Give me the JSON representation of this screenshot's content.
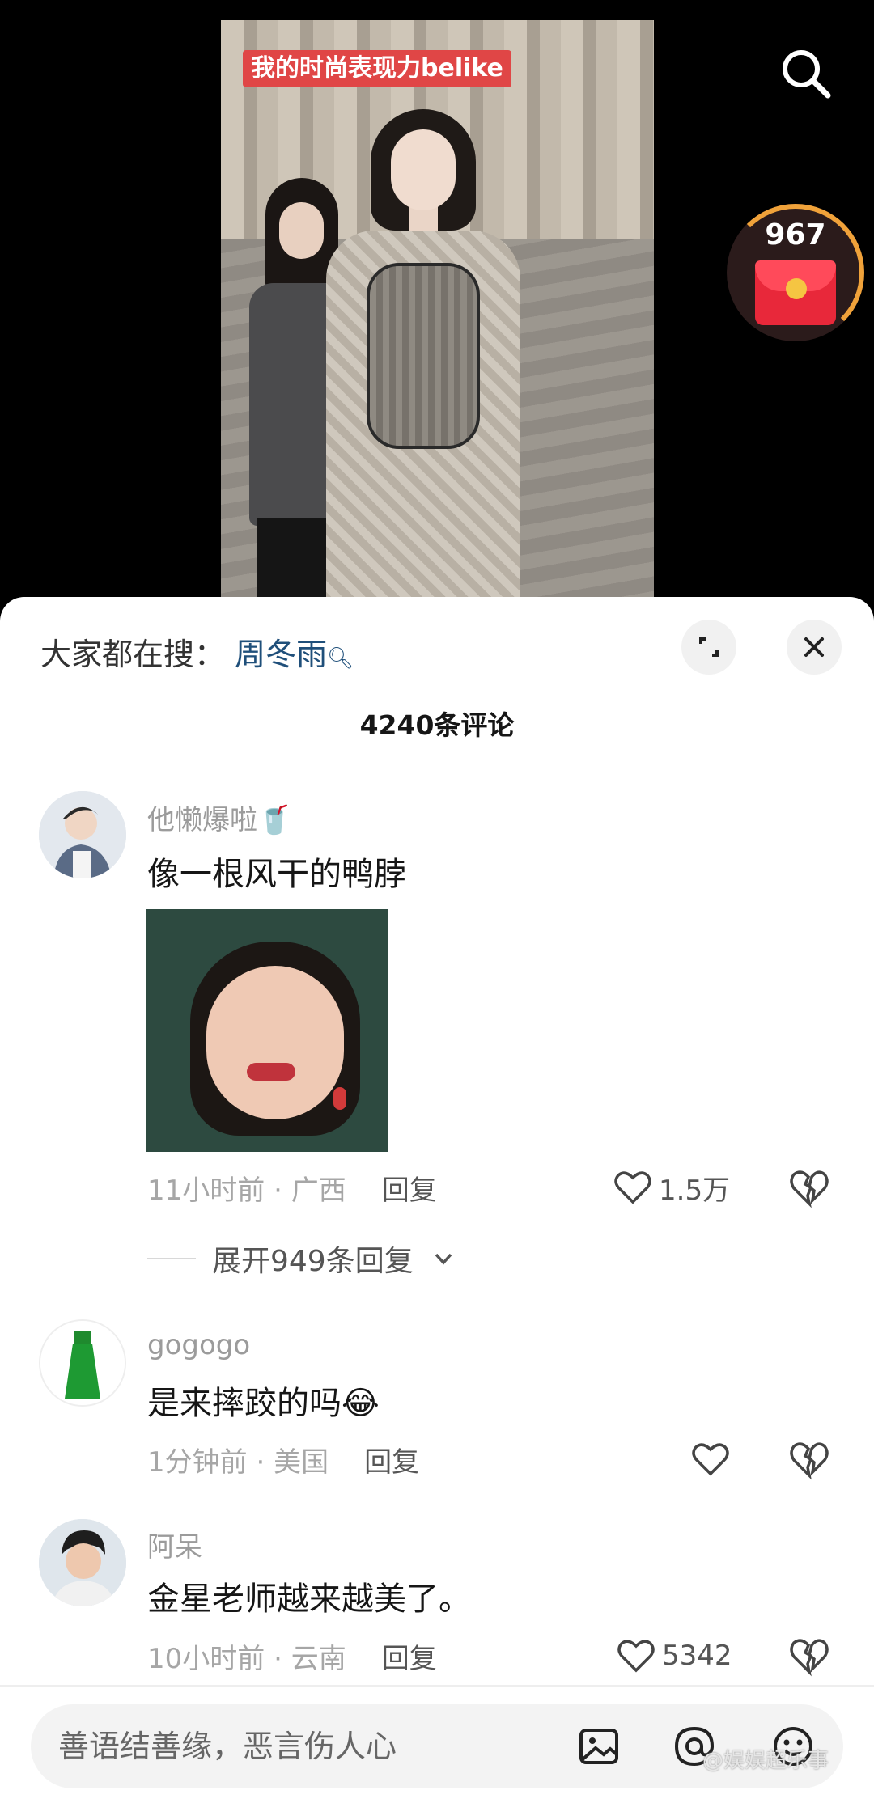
{
  "video": {
    "caption": "我的时尚表现力belike",
    "reward_count": "967"
  },
  "sheet": {
    "hot_search_label": "大家都在搜：",
    "hot_search_term": "周冬雨",
    "comment_count": "4240条评论",
    "expand_replies_label": "展开949条回复"
  },
  "comments": [
    {
      "username": "他懒爆啦🥤",
      "text": "像一根风干的鸭脖",
      "time": "11小时前",
      "location": "广西",
      "reply_label": "回复",
      "likes": "1.5万"
    },
    {
      "username": "gogogo",
      "text": "是来摔跤的吗😂",
      "time": "1分钟前",
      "location": "美国",
      "reply_label": "回复",
      "likes": ""
    },
    {
      "username": "阿呆",
      "text": "金星老师越来越美了。",
      "time": "10小时前",
      "location": "云南",
      "reply_label": "回复",
      "likes": "5342"
    }
  ],
  "input": {
    "placeholder": "善语结善缘，恶言伤人心"
  },
  "watermark": "@娱娱超乐事",
  "colors": {
    "caption_bg": "#e04646",
    "hot_search_term": "#1f4f7a",
    "reward_ring": "#f0a23a",
    "red_envelope": "#e8283a"
  },
  "icons": [
    "search-icon",
    "red-envelope-icon",
    "expand-icon",
    "close-icon",
    "heart-icon",
    "broken-heart-icon",
    "chevron-down-icon",
    "image-icon",
    "at-icon",
    "emoji-icon",
    "magnifier-icon"
  ]
}
